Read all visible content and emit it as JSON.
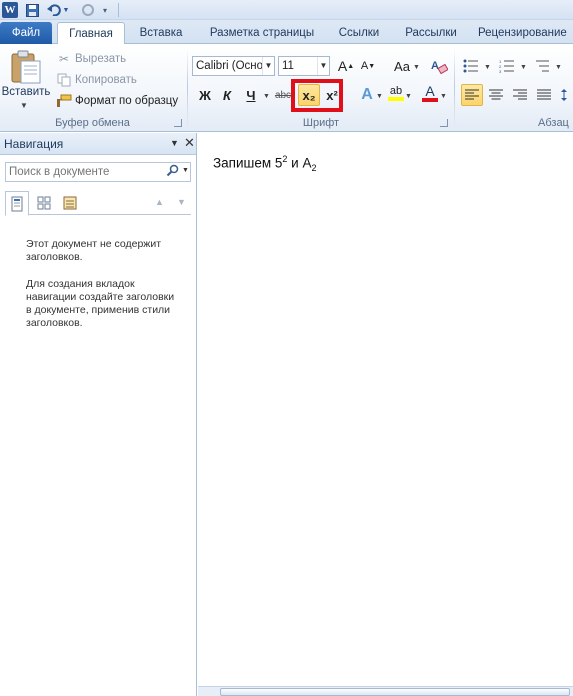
{
  "tabs": [
    {
      "label": "Файл"
    },
    {
      "label": "Главная"
    },
    {
      "label": "Вставка"
    },
    {
      "label": "Разметка страницы"
    },
    {
      "label": "Ссылки"
    },
    {
      "label": "Рассылки"
    },
    {
      "label": "Рецензирование"
    }
  ],
  "clipboard": {
    "paste_label": "Вставить",
    "cut_label": "Вырезать",
    "copy_label": "Копировать",
    "format_painter_label": "Формат по образцу",
    "group_label": "Буфер обмена"
  },
  "font": {
    "font_name": "Calibri (Осно",
    "font_size": "11",
    "bold": "Ж",
    "italic": "К",
    "underline": "Ч",
    "strike": "abc",
    "subscript": "x₂",
    "superscript": "x²",
    "grow": "A",
    "shrink": "A",
    "case": "Aa",
    "clear": "A",
    "effects": "A",
    "highlight": "ab",
    "color": "A",
    "group_label": "Шрифт"
  },
  "paragraph": {
    "group_label": "Абзац"
  },
  "navigation": {
    "title": "Навигация",
    "search_placeholder": "Поиск в документе",
    "message_1": "Этот документ не содержит заголовков.",
    "message_2": "Для создания вкладок навигации создайте заголовки в документе, применив стили заголовков."
  },
  "document": {
    "text_before": "Запишем 5",
    "sup": "2",
    "text_mid": " и A",
    "sub": "2"
  },
  "colors": {
    "highlight_box": "#e0101a",
    "active_button": "#fbd46b",
    "accent": "#2b5797"
  },
  "icons": {
    "save": "save-icon",
    "undo": "undo-icon",
    "redo": "redo-icon"
  }
}
